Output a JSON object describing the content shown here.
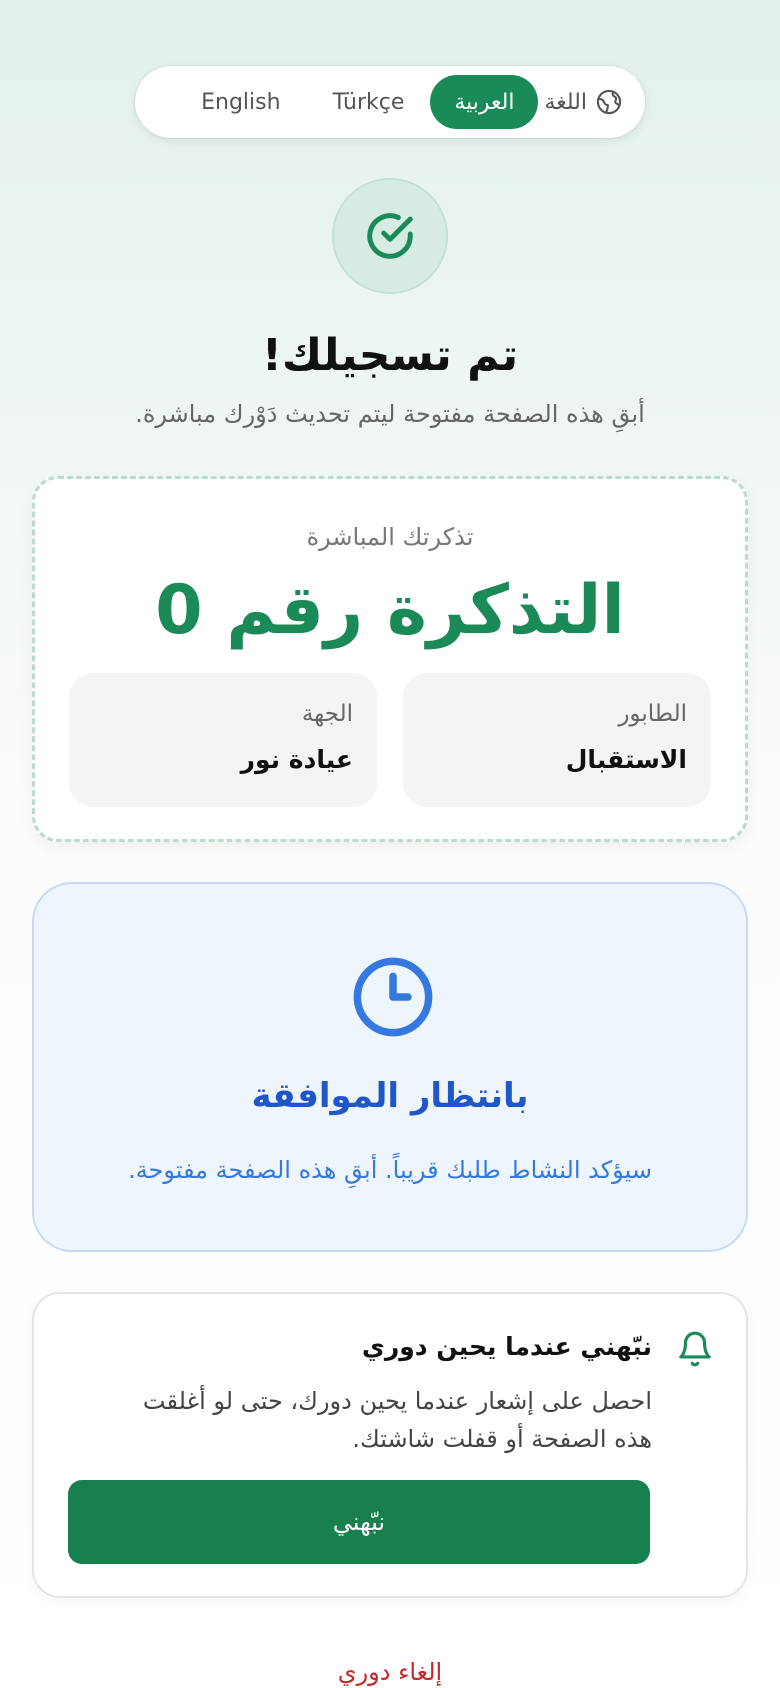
{
  "language": {
    "label": "اللغة",
    "options": [
      {
        "label": "العربية",
        "active": true
      },
      {
        "label": "Türkçe",
        "active": false
      },
      {
        "label": "English",
        "active": false
      }
    ]
  },
  "header": {
    "title": "تم تسجيلك!",
    "subtitle": "أبقِ هذه الصفحة مفتوحة ليتم تحديث دَوْرك مباشرة."
  },
  "ticket": {
    "caption": "تذكرتك المباشرة",
    "number": "التذكرة رقم 0",
    "queue_label": "الطابور",
    "queue_value": "الاستقبال",
    "dept_label": "الجهة",
    "dept_value": "عيادة نور"
  },
  "waiting": {
    "title": "بانتظار الموافقة",
    "text": "سيؤكد النشاط طلبك قريباً. أبقِ هذه الصفحة مفتوحة."
  },
  "notify": {
    "title": "نبّهني عندما يحين دوري",
    "text": "احصل على إشعار عندما يحين دورك، حتى لو أغلقت هذه الصفحة أو قفلت شاشتك.",
    "button_label": "نبّهني"
  },
  "cancel_label": "إلغاء دوري",
  "colors": {
    "brand_green": "#1a8a58",
    "waiting_blue": "#1f56c8",
    "cancel_red": "#c62828"
  },
  "icons": {
    "language": "globe-icon",
    "status": "check-circle-icon",
    "waiting": "clock-icon",
    "notify": "bell-icon"
  }
}
